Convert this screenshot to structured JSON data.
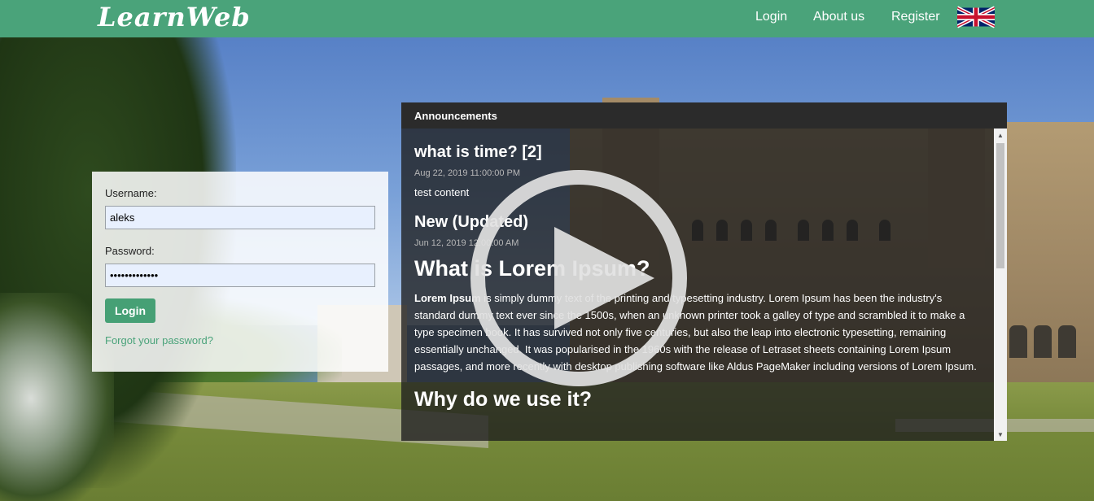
{
  "header": {
    "logo": "LearnWeb",
    "nav": [
      {
        "label": "Login"
      },
      {
        "label": "About us"
      },
      {
        "label": "Register"
      }
    ],
    "language_icon": "uk-flag-icon",
    "bg_color": "#4aa37a"
  },
  "login": {
    "username_label": "Username:",
    "username_value": "aleks",
    "password_label": "Password:",
    "password_value": "•••••••••••••",
    "login_button": "Login",
    "forgot_link": "Forgot your password?"
  },
  "announcements": {
    "heading": "Announcements",
    "items": [
      {
        "title": "what is time? [2]",
        "date": "Aug 22, 2019 11:00:00 PM",
        "text": "test content"
      },
      {
        "title": "New (Updated)",
        "date": "Jun 12, 2019 12:00:00 AM"
      }
    ],
    "h1": "What is Lorem Ipsum?",
    "para_bold": "Lorem Ipsum",
    "para": " is simply dummy text of the printing and typesetting industry. Lorem Ipsum has been the industry's standard dummy text ever since the 1500s, when an unknown printer took a galley of type and scrambled it to make a type specimen book. It has survived not only five centuries, but also the leap into electronic typesetting, remaining essentially unchanged. It was popularised in the 1960s with the release of Letraset sheets containing Lorem Ipsum passages, and more recently with desktop publishing software like Aldus PageMaker including versions of Lorem Ipsum.",
    "h2": "Why do we use it?"
  },
  "overlay": {
    "icon": "play-icon"
  }
}
